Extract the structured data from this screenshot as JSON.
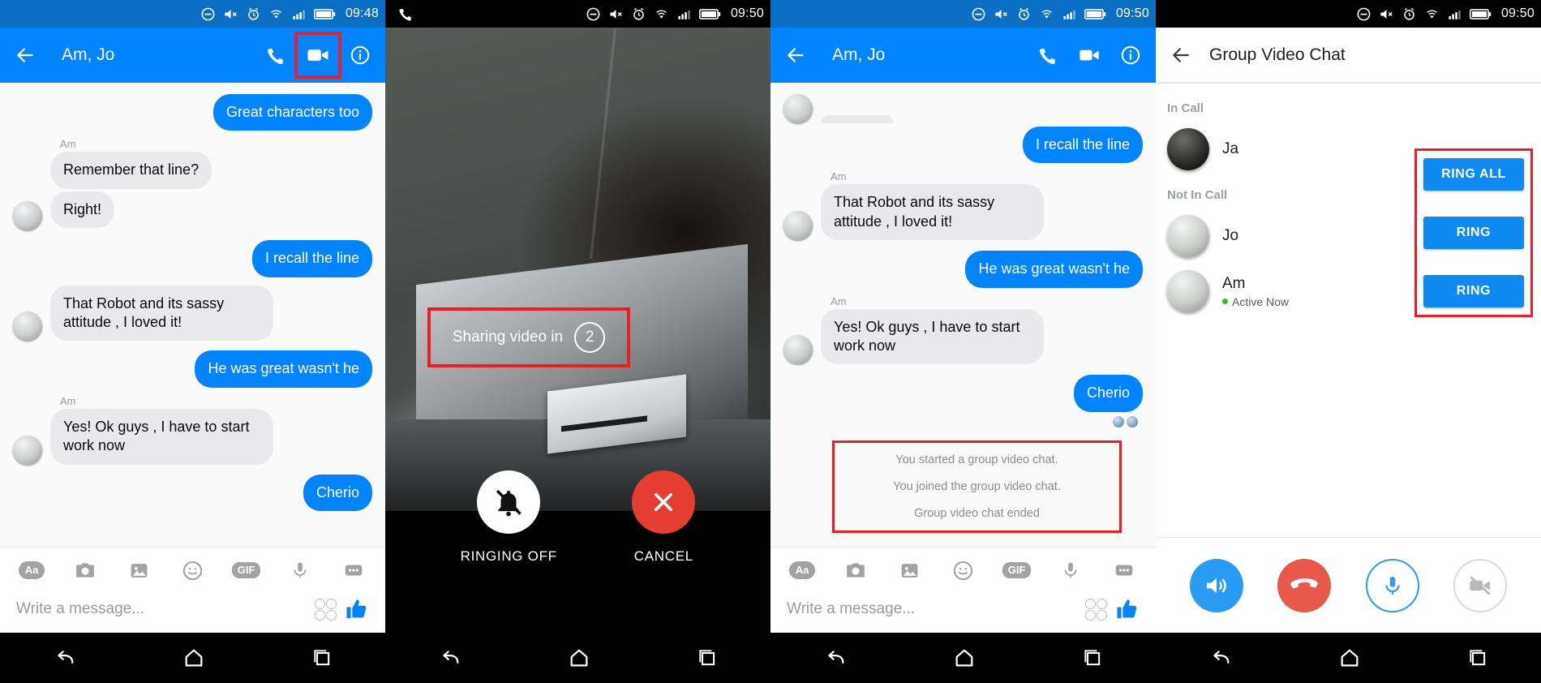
{
  "panels": [
    {
      "status": {
        "time": "09:48"
      },
      "appbar": {
        "title": "Am, Jo"
      },
      "messages": [
        {
          "side": "out",
          "text": "Great characters too"
        },
        {
          "side": "in",
          "sender": "Am",
          "texts": [
            "Remember that line?",
            "Right!"
          ]
        },
        {
          "side": "out",
          "text": "I recall the line"
        },
        {
          "side": "in",
          "texts": [
            "That Robot and its sassy attitude , I loved it!"
          ]
        },
        {
          "side": "out",
          "text": "He was great wasn't he"
        },
        {
          "side": "in",
          "sender": "Am",
          "texts": [
            "Yes! Ok guys , I have to start work now"
          ]
        },
        {
          "side": "out",
          "text": "Cherio"
        }
      ],
      "composer": {
        "tools": [
          "text-format-icon",
          "camera-icon",
          "gallery-icon",
          "emoji-icon",
          "gif-icon",
          "microphone-icon",
          "more-icon"
        ],
        "tool_labels": {
          "text": "Aa",
          "gif": "GIF"
        },
        "placeholder": "Write a message..."
      }
    },
    {
      "status": {
        "time": "09:50"
      },
      "overlay": {
        "share_text": "Sharing video in",
        "counter": "2"
      },
      "controls": [
        {
          "name": "ringing-off",
          "label": "RINGING OFF",
          "icon": "bell-off-icon"
        },
        {
          "name": "cancel",
          "label": "CANCEL",
          "icon": "close-icon"
        }
      ]
    },
    {
      "status": {
        "time": "09:50"
      },
      "appbar": {
        "title": "Am, Jo"
      },
      "messages": [
        {
          "side": "out",
          "text": "I recall the line"
        },
        {
          "side": "in",
          "sender": "Am",
          "texts": [
            "That Robot and its sassy attitude , I loved it!"
          ]
        },
        {
          "side": "out",
          "text": "He was great wasn't he"
        },
        {
          "side": "in",
          "sender": "Am",
          "texts": [
            "Yes! Ok guys , I have to start work now"
          ]
        },
        {
          "side": "out",
          "text": "Cherio"
        }
      ],
      "system_messages": [
        "You started a group video chat.",
        "You joined the group video chat.",
        "Group video chat ended"
      ],
      "composer": {
        "tool_labels": {
          "text": "Aa",
          "gif": "GIF"
        },
        "placeholder": "Write a message..."
      }
    },
    {
      "status": {
        "time": "09:50"
      },
      "appbar": {
        "title": "Group Video Chat"
      },
      "sections": [
        {
          "label": "In Call",
          "people": [
            {
              "name": "Ja",
              "status": "",
              "avatar": "dark",
              "action": ""
            }
          ]
        },
        {
          "label": "Not In Call",
          "people": [
            {
              "name": "Jo",
              "status": "",
              "avatar": "light",
              "action": "RING"
            },
            {
              "name": "Am",
              "status": "Active Now",
              "avatar": "light",
              "action": "RING"
            }
          ]
        }
      ],
      "ring_all_label": "RING ALL",
      "ring_label": "RING",
      "call_controls": [
        {
          "name": "speaker-button",
          "icon": "speaker-icon"
        },
        {
          "name": "end-call-button",
          "icon": "phone-hangup-icon"
        },
        {
          "name": "microphone-button",
          "icon": "microphone-icon"
        },
        {
          "name": "video-off-button",
          "icon": "video-off-icon"
        }
      ]
    }
  ],
  "colors": {
    "messenger_blue": "#0084ff",
    "status_blue": "#0a6fc2",
    "highlight_red": "#ee1c25",
    "bubble_gray": "#e9e9eb",
    "end_call_red": "#e8594a",
    "active_green": "#42b72a"
  },
  "nav": {
    "back": "back-icon",
    "home": "home-icon",
    "recents": "recents-icon"
  }
}
